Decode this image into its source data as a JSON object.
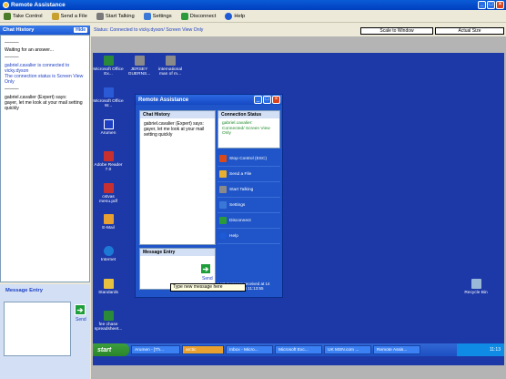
{
  "window": {
    "title": "Remote Assistance",
    "buttons": [
      "_",
      "□",
      "×"
    ]
  },
  "toolbar": [
    {
      "label": "Take Control",
      "icon": "take-control-icon",
      "color": "#4a7c2a"
    },
    {
      "label": "Send a File",
      "icon": "send-file-icon",
      "color": "#c8a030"
    },
    {
      "label": "Start Talking",
      "icon": "microphone-icon",
      "color": "#7a7a7a"
    },
    {
      "label": "Settings",
      "icon": "settings-icon",
      "color": "#3a78d8"
    },
    {
      "label": "Disconnect",
      "icon": "disconnect-icon",
      "color": "#2a9a3a"
    },
    {
      "label": "Help",
      "icon": "help-icon",
      "color": "#1c5ad6"
    }
  ],
  "left_pane": {
    "chat_history": {
      "title": "Chat History",
      "hide_label": "Hide"
    },
    "chat": {
      "line1": "Waiting for an answer...",
      "line2": "gabriel.cavalier is connected to vicky.dyson",
      "line3": "The connection status is Screen View Only",
      "line4": "gabriel.cavalier (Expert) says:",
      "line5": " gayer, let me look at your mail setting quickly"
    },
    "message_entry": {
      "title": "Message Entry",
      "send_label": "Send"
    }
  },
  "status": {
    "text": "Status: Connected to vicky.dyson/ Screen View Only",
    "scale_btn": "Scale to Window",
    "actual_btn": "Actual Size"
  },
  "desktop_icons": [
    {
      "label": "Microsoft Office Ex...",
      "color": "#2a8a3a"
    },
    {
      "label": "JERSEY GUERNS...",
      "color": "#8a8a8a"
    },
    {
      "label": "international man of m...",
      "color": "#8a8a8a"
    },
    {
      "label": "Microsoft Office W...",
      "color": "#2a5ad6"
    },
    {
      "label": "Arumen",
      "color": "#1c3fc4"
    },
    {
      "label": "Adobe Reader 7.0",
      "color": "#c83030"
    },
    {
      "label": "cstvas menu.pdf",
      "color": "#c83030"
    },
    {
      "label": "E-Mail",
      "color": "#e8a030"
    },
    {
      "label": "Internet",
      "color": "#1c7ad6"
    },
    {
      "label": "Standards",
      "color": "#e8c040"
    },
    {
      "label": "fee chase spreadsheet...",
      "color": "#2a8a3a"
    },
    {
      "label": "Recycle Bin",
      "color": "#9ab8d8"
    }
  ],
  "taskbar": {
    "start_label": "start",
    "buttons": [
      "Arumen - [Th...",
      "arctic",
      "Inbox - Micro...",
      "Microsoft Exc...",
      "UK MSN.com ...",
      "Remote Assis..."
    ],
    "tray_time": "11:13"
  },
  "ra_dialog": {
    "title": "Remote Assistance",
    "chat_title": "Chat History",
    "chat_text": "gabriel.cavalier (Expert) says: gayer, let me look at your mail setting quickly",
    "entry_title": "Message Entry",
    "send_label": "Send",
    "status_title": "Connection Status",
    "status_text": "gabriel.cavalier: Connected/ Screen View Only",
    "actions": [
      {
        "label": "Stop Control (ESC)",
        "color": "#d84a1a"
      },
      {
        "label": "Send a File",
        "color": "#e8b030"
      },
      {
        "label": "Start Talking",
        "color": "#8a8a8a"
      },
      {
        "label": "Settings",
        "color": "#3a78d8"
      },
      {
        "label": "Disconnect",
        "color": "#2a9a3a"
      },
      {
        "label": "Help",
        "color": "#1c5ad6"
      }
    ],
    "last_msg": "Last message received at 14 December 2006 11:13:55"
  },
  "tooltip": "Type new message here"
}
